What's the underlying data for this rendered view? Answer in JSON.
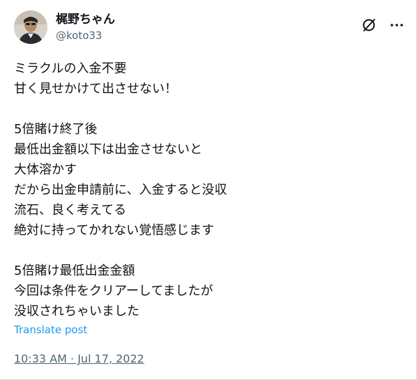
{
  "author": {
    "display_name": "梶野ちゃん",
    "handle": "@koto33"
  },
  "header_icons": {
    "grok": "slashed-circle-icon",
    "more": "more-dots-icon"
  },
  "post": {
    "text": "ミラクルの入金不要\n甘く見せかけて出させない！\n\n5倍賭け終了後\n最低出金額以下は出金させないと\n大体溶かす\nだから出金申請前に、入金すると没収\n流石、良く考えてる\n絶対に持ってかれない覚悟感じます\n\n5倍賭け最低出金金額\n今回は条件をクリアーしてましたが\n没収されちゃいました",
    "translate_label": "Translate post",
    "timestamp": "10:33 AM · Jul 17, 2022"
  },
  "colors": {
    "text": "#0f1419",
    "secondary": "#536471",
    "link": "#1d9bf0"
  }
}
